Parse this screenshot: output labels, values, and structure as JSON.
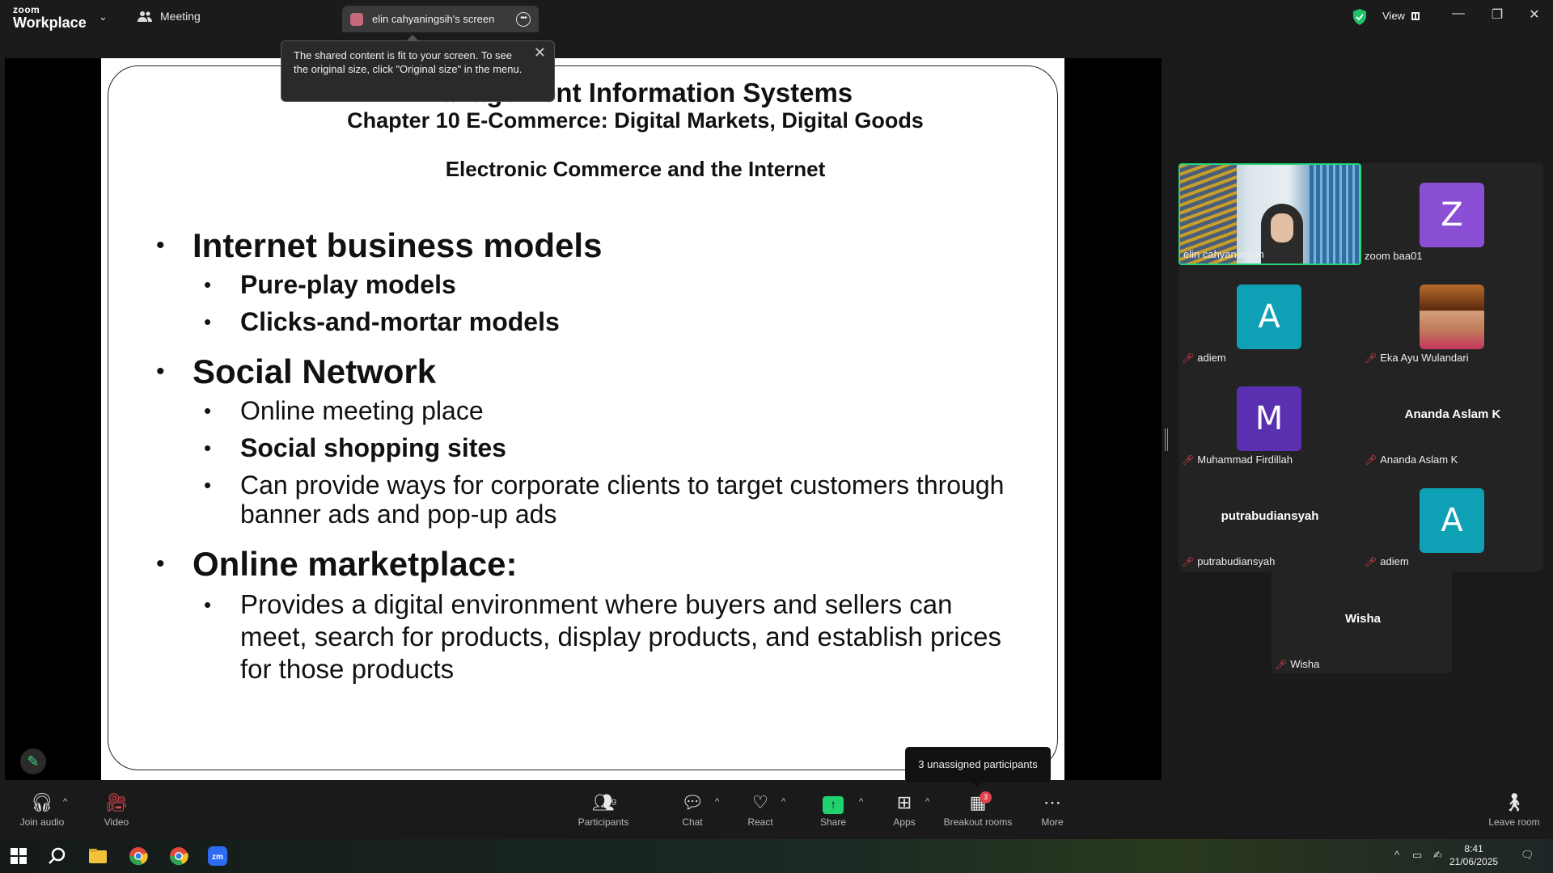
{
  "titlebar": {
    "brand_small": "zoom",
    "brand_big": "Workplace",
    "meeting_label": "Meeting",
    "share_tab_label": "elin cahyaningsih's screen",
    "view_label": "View"
  },
  "tooltip": {
    "text": "The shared content is fit to your screen. To see the original size, click \"Original size\" in the menu."
  },
  "slide": {
    "title": "Management Information Systems",
    "subtitle": "Chapter 10 E-Commerce: Digital Markets, Digital Goods",
    "heading": "Electronic Commerce and the Internet",
    "bullets": {
      "b1": "Internet business models",
      "b1a": "Pure-play models",
      "b1b": "Clicks-and-mortar models",
      "b2": "Social Network",
      "b2a": "Online meeting place",
      "b2b": "Social shopping sites",
      "b2c": "Can provide ways for corporate clients to target customers through banner ads and pop-up ads",
      "b3": "Online marketplace:",
      "b3a": "Provides a digital environment where buyers and sellers can meet, search for products, display products, and establish prices for those products"
    },
    "bullet_char": "•"
  },
  "participants": [
    {
      "name": "elin cahyaningsih",
      "type": "video",
      "muted": false
    },
    {
      "name": "zoom baa01",
      "type": "avatar",
      "initial": "Z",
      "color": "#8b4fd6",
      "muted": false
    },
    {
      "name": "adiem",
      "type": "avatar",
      "initial": "A",
      "color": "#0ea0b4",
      "muted": true
    },
    {
      "name": "Eka Ayu Wulandari",
      "type": "photo",
      "muted": true
    },
    {
      "name": "Muhammad Firdillah",
      "type": "avatar",
      "initial": "M",
      "color": "#5a2fb0",
      "muted": true
    },
    {
      "name": "Ananda Aslam K",
      "type": "name",
      "muted": true
    },
    {
      "name": "putrabudiansyah",
      "type": "name",
      "muted": true
    },
    {
      "name": "adiem",
      "type": "avatar",
      "initial": "A",
      "color": "#0ea0b4",
      "muted": true
    },
    {
      "name": "Wisha",
      "type": "name",
      "muted": true
    }
  ],
  "breakout_tooltip": "3 unassigned participants",
  "toolbar": {
    "join_audio": "Join audio",
    "video": "Video",
    "participants": "Participants",
    "participants_count": "9",
    "chat": "Chat",
    "react": "React",
    "share": "Share",
    "apps": "Apps",
    "breakout_rooms": "Breakout rooms",
    "breakout_badge": "3",
    "more": "More",
    "leave_room": "Leave room"
  },
  "taskbar": {
    "time": "8:41",
    "date": "21/06/2025"
  },
  "colors": {
    "accent_green": "#24d87f",
    "mute_red": "#e0414b",
    "share_green": "#1fd16f"
  }
}
